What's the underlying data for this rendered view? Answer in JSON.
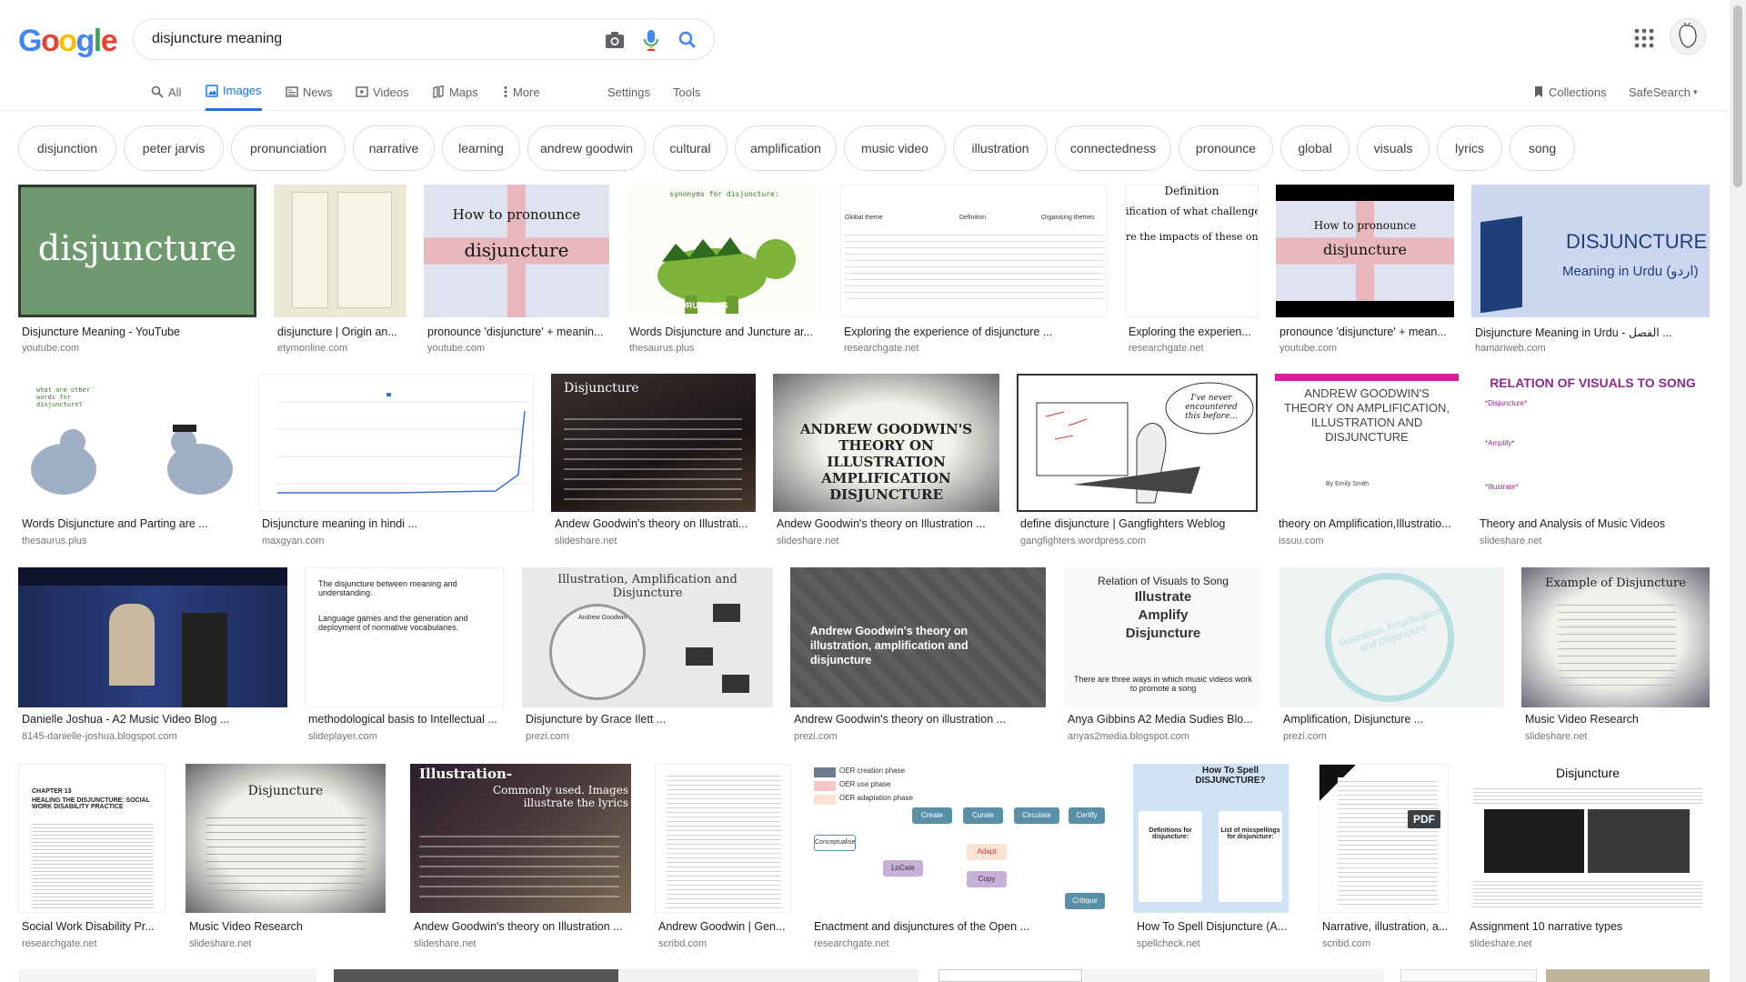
{
  "logo": "Google",
  "search": {
    "query": "disjuncture meaning"
  },
  "tabs": {
    "all": "All",
    "images": "Images",
    "news": "News",
    "videos": "Videos",
    "maps": "Maps",
    "more": "More",
    "settings": "Settings",
    "tools": "Tools",
    "collections": "Collections",
    "safesearch": "SafeSearch"
  },
  "chips": [
    "disjunction",
    "peter jarvis",
    "pronunciation",
    "narrative",
    "learning",
    "andrew goodwin",
    "cultural",
    "amplification",
    "music video",
    "illustration",
    "connectedness",
    "pronounce",
    "global",
    "visuals",
    "lyrics",
    "song"
  ],
  "results": [
    {
      "title": "Disjuncture Meaning - YouTube",
      "source": "youtube.com"
    },
    {
      "title": "disjuncture | Origin an...",
      "source": "etymonline.com"
    },
    {
      "title": "pronounce 'disjuncture' + meanin...",
      "source": "youtube.com"
    },
    {
      "title": "Words Disjuncture and Juncture ar...",
      "source": "thesaurus.plus"
    },
    {
      "title": "Exploring the experience of disjuncture ...",
      "source": "researchgate.net"
    },
    {
      "title": "Exploring the experien...",
      "source": "researchgate.net"
    },
    {
      "title": "pronounce 'disjuncture' + mean...",
      "source": "youtube.com"
    },
    {
      "title": "Disjuncture Meaning in Urdu - الفصل ...",
      "source": "hamariweb.com"
    },
    {
      "title": "Words Disjuncture and Parting are ...",
      "source": "thesaurus.plus"
    },
    {
      "title": "Disjuncture meaning in hindi ...",
      "source": "maxgyan.com"
    },
    {
      "title": "Andew Goodwin's theory on Illustrati...",
      "source": "slideshare.net"
    },
    {
      "title": "Andew Goodwin's theory on Illustration ...",
      "source": "slideshare.net"
    },
    {
      "title": "define disjuncture | Gangfighters Weblog",
      "source": "gangfighters.wordpress.com"
    },
    {
      "title": "theory on Amplification,Illustratio...",
      "source": "issuu.com"
    },
    {
      "title": "Theory and Analysis of Music Videos",
      "source": "slideshare.net"
    },
    {
      "title": "Danielle Joshua - A2 Music Video Blog ...",
      "source": "8145-danielle-joshua.blogspot.com"
    },
    {
      "title": "methodological basis to Intellectual ...",
      "source": "slideplayer.com"
    },
    {
      "title": "Disjuncture by Grace Ilett ...",
      "source": "prezi.com"
    },
    {
      "title": "Andrew Goodwin's theory on illustration ...",
      "source": "prezi.com"
    },
    {
      "title": "Anya Gibbins A2 Media Sudies Blo...",
      "source": "anyas2media.blogspot.com"
    },
    {
      "title": "Amplification, Disjuncture ...",
      "source": "prezi.com"
    },
    {
      "title": "Music Video Research",
      "source": "slideshare.net"
    },
    {
      "title": "Social Work Disability Pr...",
      "source": "researchgate.net"
    },
    {
      "title": "Music Video Research",
      "source": "slideshare.net"
    },
    {
      "title": "Andew Goodwin's theory on Illustration ...",
      "source": "slideshare.net"
    },
    {
      "title": "Andrew Goodwin | Gen...",
      "source": "scribd.com"
    },
    {
      "title": "Enactment and disjunctures of the Open ...",
      "source": "researchgate.net"
    },
    {
      "title": "How To Spell Disjuncture (A...",
      "source": "spellcheck.net"
    },
    {
      "title": "Narrative, illustration, a...",
      "source": "scribd.com"
    },
    {
      "title": "Assignment 10 narrative types",
      "source": "slideshare.net"
    }
  ],
  "thumbs": {
    "t0": "disjuncture",
    "t2a": "How to pronounce",
    "t2b": "disjuncture",
    "t3a": "synonyms for disjuncture:",
    "t3b": "THESAURUS.PLUS",
    "t4a": "Global theme",
    "t4b": "Definition",
    "t4c": "Organising themes",
    "t5a": "Definition",
    "t5b": "ification of what challenges pe",
    "t5c": "re the impacts of these on-g",
    "t6a": "How to pronounce",
    "t6b": "disjuncture",
    "t7a": "DISJUNCTURE",
    "t7b": "Meaning in Urdu (اردو)",
    "t8": "what are other words for disjuncture?",
    "t10": "Disjuncture",
    "t11": "ANDREW GOODWIN'S THEORY ON ILLUSTRATION AMPLIFICATION DISJUNCTURE",
    "t12": "I've never encountered this before...",
    "t13a": "ANDREW GOODWIN'S THEORY ON AMPLIFICATION, ILLUSTRATION AND DISJUNCTURE",
    "t13b": "By Emily Smith",
    "t14a": "RELATION OF VISUALS TO SONG",
    "t14b": "*Disjuncture*",
    "t14c": "*Amplify*",
    "t14d": "*Illustrate*",
    "t16a": "The disjuncture between meaning and understanding.",
    "t16b": "Language games and the generation and deployment of normative vocabularies.",
    "t17a": "Illustration, Amplification and Disjuncture",
    "t17b": "Andrew Goodwin",
    "t18": "Andrew Goodwin's theory on illustration, amplification and disjuncture",
    "t19a": "Relation of Visuals to Song",
    "t19b": "Illustrate",
    "t19c": "Amplify",
    "t19d": "Disjuncture",
    "t19e": "There are three ways in which music videos work to promote a song",
    "t20": "Illustration, Amplification and Disjuncture",
    "t21": "Example of Disjuncture",
    "t22a": "CHAPTER 13",
    "t22b": "HEALING THE DISJUNCTURE: SOCIAL WORK DISABILITY PRACTICE",
    "t23": "Disjuncture",
    "t24a": "Illustration-",
    "t24b": "Commonly used. Images illustrate the lyrics",
    "t26a": "OER creation phase",
    "t26b": "OER use phase",
    "t26c": "OER adaptation phase",
    "t26d": "Create",
    "t26e": "Curate",
    "t26f": "Circulate",
    "t26g": "Certify",
    "t26h": "Conceptualise",
    "t26i": "Adapt",
    "t26j": "Copy",
    "t26k": "Critique",
    "t26l": "LoCate",
    "t27a": "How To Spell DISJUNCTURE?",
    "t27b": "Definitions for disjuncture:",
    "t27c": "List of misspellings for disjuncture:",
    "t28": "PDF",
    "t29": "Disjuncture"
  }
}
